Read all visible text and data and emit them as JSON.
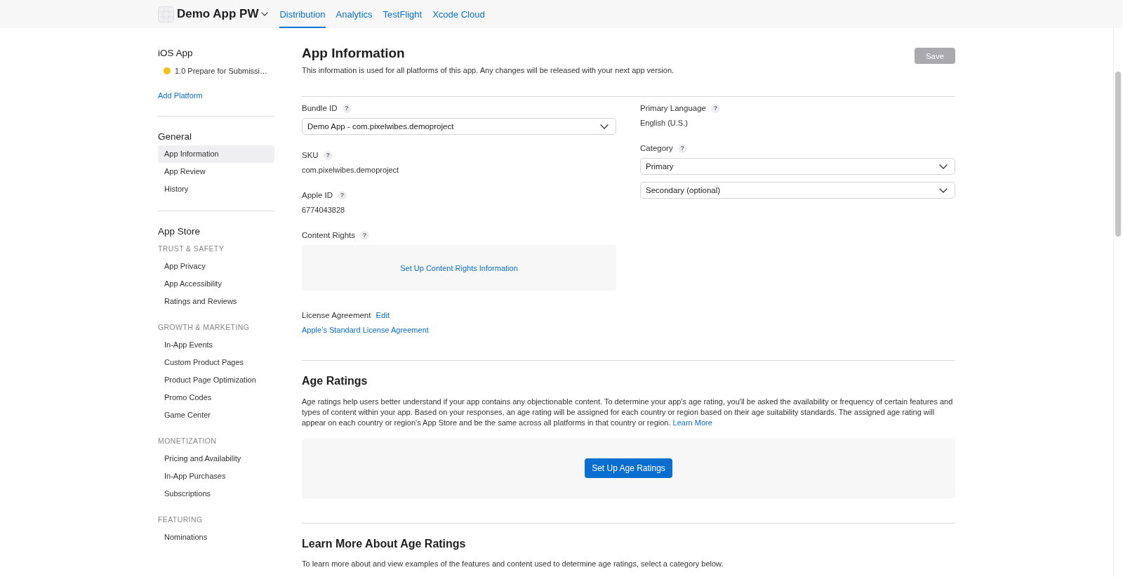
{
  "top_bar": {
    "app_name": "Demo App PW",
    "tabs": [
      {
        "label": "Distribution",
        "selected": true
      },
      {
        "label": "Analytics",
        "selected": false
      },
      {
        "label": "TestFlight",
        "selected": false
      },
      {
        "label": "Xcode Cloud",
        "selected": false
      }
    ]
  },
  "sidebar": {
    "platform": {
      "title": "iOS App",
      "versions": [
        {
          "label": "1.0 Prepare for Submissi…",
          "color": "#f5c211"
        }
      ],
      "add_link": "Add Platform"
    },
    "sections": [
      {
        "title": "General",
        "groups": [
          {
            "items": [
              {
                "label": "App Information",
                "selected": true
              },
              {
                "label": "App Review",
                "selected": false
              },
              {
                "label": "History",
                "selected": false
              }
            ]
          }
        ]
      },
      {
        "title": "App Store",
        "groups": [
          {
            "heading": "TRUST & SAFETY",
            "items": [
              {
                "label": "App Privacy",
                "selected": false
              },
              {
                "label": "App Accessibility",
                "selected": false
              },
              {
                "label": "Ratings and Reviews",
                "selected": false
              }
            ]
          },
          {
            "heading": "GROWTH & MARKETING",
            "items": [
              {
                "label": "In-App Events",
                "selected": false
              },
              {
                "label": "Custom Product Pages",
                "selected": false
              },
              {
                "label": "Product Page Optimization",
                "selected": false
              },
              {
                "label": "Promo Codes",
                "selected": false
              },
              {
                "label": "Game Center",
                "selected": false
              }
            ]
          },
          {
            "heading": "MONETIZATION",
            "items": [
              {
                "label": "Pricing and Availability",
                "selected": false
              },
              {
                "label": "In-App Purchases",
                "selected": false
              },
              {
                "label": "Subscriptions",
                "selected": false
              }
            ]
          },
          {
            "heading": "FEATURING",
            "items": [
              {
                "label": "Nominations",
                "selected": false
              }
            ]
          }
        ]
      }
    ]
  },
  "main": {
    "app_information": {
      "title": "App Information",
      "description": "This information is used for all platforms of this app. Any changes will be released with your next app version.",
      "save_button": {
        "label": "Save",
        "disabled": true
      },
      "left_fields": [
        {
          "kind": "select",
          "label": "Bundle ID",
          "help": "?",
          "value": "Demo App - com.pixelwibes.demoproject"
        },
        {
          "kind": "text",
          "label": "SKU",
          "help": "?",
          "value": "com.pixelwibes.demoproject"
        },
        {
          "kind": "text",
          "label": "Apple ID",
          "help": "?",
          "value": "6774043828"
        },
        {
          "kind": "panel",
          "label": "Content Rights",
          "help": "?",
          "link": "Set Up Content Rights Information"
        },
        {
          "kind": "license",
          "label": "License Agreement",
          "edit_link": "Edit",
          "link": "Apple’s Standard License Agreement"
        }
      ],
      "right_fields": [
        {
          "kind": "text",
          "label": "Primary Language",
          "help": "?",
          "value": "English (U.S.)"
        },
        {
          "kind": "select_group",
          "label": "Category",
          "help": "?",
          "selects": [
            {
              "value": "Primary"
            },
            {
              "value": "Secondary (optional)"
            }
          ]
        }
      ]
    },
    "age_ratings": {
      "title": "Age Ratings",
      "description": "Age ratings help users better understand if your app contains any objectionable content. To determine your app's age rating, you'll be asked the availability or frequency of certain features and types of content within your app. Based on your responses, an age rating will be assigned for each country or region based on their age suitability standards. The assigned age rating will appear on each country or region's App Store and be the same across all platforms in that country or region.",
      "learn_more_link": "Learn More",
      "button": "Set Up Age Ratings"
    },
    "learn_more": {
      "title": "Learn More About Age Ratings",
      "description": "To learn more about and view examples of the features and content used to determine age ratings, select a category below."
    }
  }
}
